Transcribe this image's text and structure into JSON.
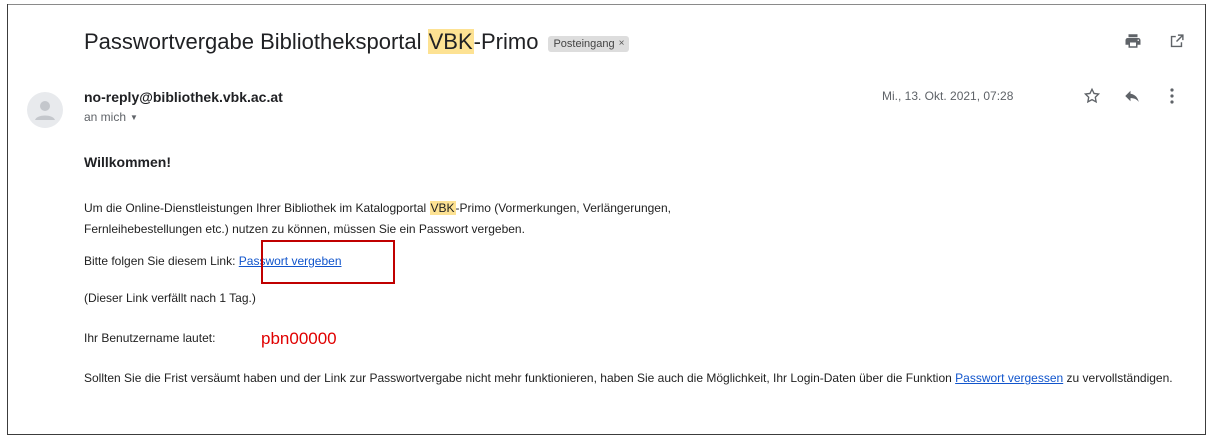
{
  "email": {
    "subject_pre": "Passwortvergabe Bibliotheksportal ",
    "subject_hl": "VBK",
    "subject_post": "-Primo",
    "label": "Posteingang",
    "label_close": "×",
    "sender": "no-reply@bibliothek.vbk.ac.at",
    "recipient": "an mich",
    "date": "Mi., 13. Okt. 2021, 07:28"
  },
  "body": {
    "welcome": "Willkommen!",
    "p1_a": "Um die Online-Dienstleistungen Ihrer Bibliothek im Katalogportal ",
    "p1_hl": "VBK",
    "p1_b": "-Primo (Vormerkungen, Verlängerungen,",
    "p1_c": "Fernleihebestellungen etc.) nutzen zu können, müssen Sie ein Passwort vergeben.",
    "p2": "Bitte folgen Sie diesem Link: ",
    "link1": "Passwort vergeben",
    "p3": "(Dieser Link verfällt nach 1 Tag.)",
    "p4": "Ihr Benutzername lautet:",
    "username": "pbn00000",
    "p5_a": "Sollten Sie die Frist versäumt haben und der Link zur Passwortvergabe nicht mehr funktionieren, haben Sie auch die Möglichkeit, Ihr Login-Daten über die Funktion ",
    "link2": "Passwort vergessen",
    "p5_b": " zu vervollständigen."
  },
  "icons": [
    "print-icon",
    "open-in-new-window-icon",
    "star-icon",
    "reply-icon",
    "more-vert-icon",
    "avatar-icon"
  ],
  "colors": {
    "highlight": "#fde293",
    "link": "#1155cc",
    "annotation": "#c00000",
    "username": "#e00000"
  }
}
